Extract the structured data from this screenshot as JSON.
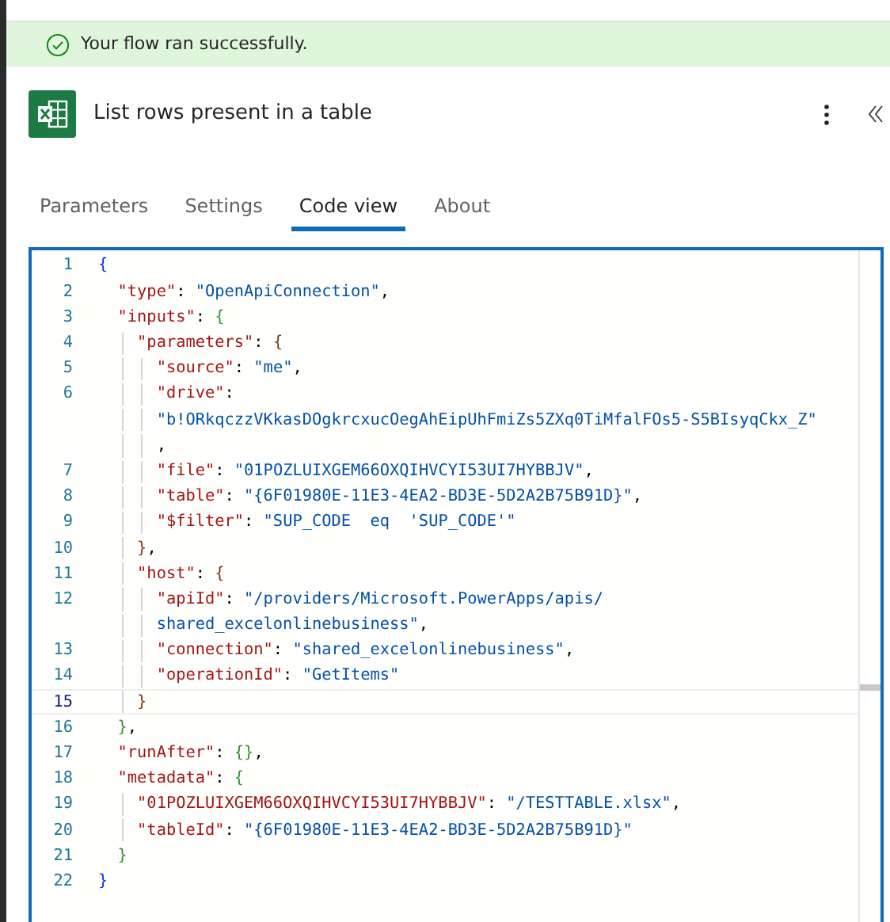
{
  "banner": {
    "text": "Your flow ran successfully."
  },
  "header": {
    "title": "List rows present in a table"
  },
  "tabs": [
    {
      "label": "Parameters",
      "selected": false
    },
    {
      "label": "Settings",
      "selected": false
    },
    {
      "label": "Code view",
      "selected": true
    },
    {
      "label": "About",
      "selected": false
    }
  ],
  "code": {
    "lines": [
      {
        "number": "1",
        "selected": false,
        "tokens": [
          {
            "kind": "brace",
            "text": "{",
            "color": "#0431fa"
          }
        ]
      },
      {
        "number": "2",
        "selected": false,
        "tokens": [
          {
            "kind": "key",
            "text": "  \"type\""
          },
          {
            "kind": "punct",
            "text": ": "
          },
          {
            "kind": "string",
            "text": "\"OpenApiConnection\""
          },
          {
            "kind": "punct",
            "text": ","
          }
        ]
      },
      {
        "number": "3",
        "selected": false,
        "tokens": [
          {
            "kind": "key",
            "text": "  \"inputs\""
          },
          {
            "kind": "punct",
            "text": ": "
          },
          {
            "kind": "brace",
            "text": "{",
            "color": "#319331"
          }
        ]
      },
      {
        "number": "4",
        "selected": false,
        "tokens": [
          {
            "kind": "key",
            "text": "    \"parameters\""
          },
          {
            "kind": "punct",
            "text": ": "
          },
          {
            "kind": "brace",
            "text": "{",
            "color": "#7b3814"
          }
        ]
      },
      {
        "number": "5",
        "selected": false,
        "tokens": [
          {
            "kind": "key",
            "text": "      \"source\""
          },
          {
            "kind": "punct",
            "text": ": "
          },
          {
            "kind": "string",
            "text": "\"me\""
          },
          {
            "kind": "punct",
            "text": ","
          }
        ]
      },
      {
        "number": "6",
        "selected": false,
        "tokens": [
          {
            "kind": "key",
            "text": "      \"drive\""
          },
          {
            "kind": "punct",
            "text": ":"
          }
        ]
      },
      {
        "selected": false,
        "tokens": [
          {
            "kind": "string",
            "text": "      \"b!ORkqczzVKkasDOgkrcxucOegAhEipUhFmiZs5ZXq0TiMfalFOs5-S5BIsyqCkx_Z\""
          }
        ]
      },
      {
        "selected": false,
        "tokens": [
          {
            "kind": "punct",
            "text": "      ,"
          }
        ]
      },
      {
        "number": "7",
        "selected": false,
        "tokens": [
          {
            "kind": "key",
            "text": "      \"file\""
          },
          {
            "kind": "punct",
            "text": ": "
          },
          {
            "kind": "string",
            "text": "\"01POZLUIXGEM66OXQIHVCYI53UI7HYBBJV\""
          },
          {
            "kind": "punct",
            "text": ","
          }
        ]
      },
      {
        "number": "8",
        "selected": false,
        "tokens": [
          {
            "kind": "key",
            "text": "      \"table\""
          },
          {
            "kind": "punct",
            "text": ": "
          },
          {
            "kind": "string",
            "text": "\"{6F01980E-11E3-4EA2-BD3E-5D2A2B75B91D}\""
          },
          {
            "kind": "punct",
            "text": ","
          }
        ]
      },
      {
        "number": "9",
        "selected": false,
        "tokens": [
          {
            "kind": "key",
            "text": "      \"$filter\""
          },
          {
            "kind": "punct",
            "text": ": "
          },
          {
            "kind": "string",
            "text": "\"SUP_CODE  eq  'SUP_CODE'\""
          }
        ]
      },
      {
        "number": "10",
        "selected": false,
        "tokens": [
          {
            "kind": "brace",
            "text": "    }",
            "color": "#7b3814"
          },
          {
            "kind": "punct",
            "text": ","
          }
        ]
      },
      {
        "number": "11",
        "selected": false,
        "tokens": [
          {
            "kind": "key",
            "text": "    \"host\""
          },
          {
            "kind": "punct",
            "text": ": "
          },
          {
            "kind": "brace",
            "text": "{",
            "color": "#7b3814"
          }
        ]
      },
      {
        "number": "12",
        "selected": false,
        "tokens": [
          {
            "kind": "key",
            "text": "      \"apiId\""
          },
          {
            "kind": "punct",
            "text": ": "
          },
          {
            "kind": "string",
            "text": "\"/providers/Microsoft.PowerApps/apis/"
          }
        ]
      },
      {
        "selected": false,
        "tokens": [
          {
            "kind": "string",
            "text": "      shared_excelonlinebusiness\""
          },
          {
            "kind": "punct",
            "text": ","
          }
        ]
      },
      {
        "number": "13",
        "selected": false,
        "tokens": [
          {
            "kind": "key",
            "text": "      \"connection\""
          },
          {
            "kind": "punct",
            "text": ": "
          },
          {
            "kind": "string",
            "text": "\"shared_excelonlinebusiness\""
          },
          {
            "kind": "punct",
            "text": ","
          }
        ]
      },
      {
        "number": "14",
        "selected": false,
        "tokens": [
          {
            "kind": "key",
            "text": "      \"operationId\""
          },
          {
            "kind": "punct",
            "text": ": "
          },
          {
            "kind": "string",
            "text": "\"GetItems\""
          }
        ]
      },
      {
        "number": "15",
        "selected": true,
        "tokens": [
          {
            "kind": "brace",
            "text": "    }",
            "color": "#7b3814"
          }
        ]
      },
      {
        "number": "16",
        "selected": false,
        "tokens": [
          {
            "kind": "brace",
            "text": "  }",
            "color": "#319331"
          },
          {
            "kind": "punct",
            "text": ","
          }
        ]
      },
      {
        "number": "17",
        "selected": false,
        "tokens": [
          {
            "kind": "key",
            "text": "  \"runAfter\""
          },
          {
            "kind": "punct",
            "text": ": "
          },
          {
            "kind": "brace",
            "text": "{}",
            "color": "#319331"
          },
          {
            "kind": "punct",
            "text": ","
          }
        ]
      },
      {
        "number": "18",
        "selected": false,
        "tokens": [
          {
            "kind": "key",
            "text": "  \"metadata\""
          },
          {
            "kind": "punct",
            "text": ": "
          },
          {
            "kind": "brace",
            "text": "{",
            "color": "#319331"
          }
        ]
      },
      {
        "number": "19",
        "selected": false,
        "tokens": [
          {
            "kind": "key",
            "text": "    \"01POZLUIXGEM66OXQIHVCYI53UI7HYBBJV\""
          },
          {
            "kind": "punct",
            "text": ": "
          },
          {
            "kind": "string",
            "text": "\"/TESTTABLE.xlsx\""
          },
          {
            "kind": "punct",
            "text": ","
          }
        ]
      },
      {
        "number": "20",
        "selected": false,
        "tokens": [
          {
            "kind": "key",
            "text": "    \"tableId\""
          },
          {
            "kind": "punct",
            "text": ": "
          },
          {
            "kind": "string",
            "text": "\"{6F01980E-11E3-4EA2-BD3E-5D2A2B75B91D}\""
          }
        ]
      },
      {
        "number": "21",
        "selected": false,
        "tokens": [
          {
            "kind": "brace",
            "text": "  }",
            "color": "#319331"
          }
        ]
      },
      {
        "number": "22",
        "selected": false,
        "tokens": [
          {
            "kind": "brace",
            "text": "}",
            "color": "#0431fa"
          }
        ]
      }
    ]
  }
}
